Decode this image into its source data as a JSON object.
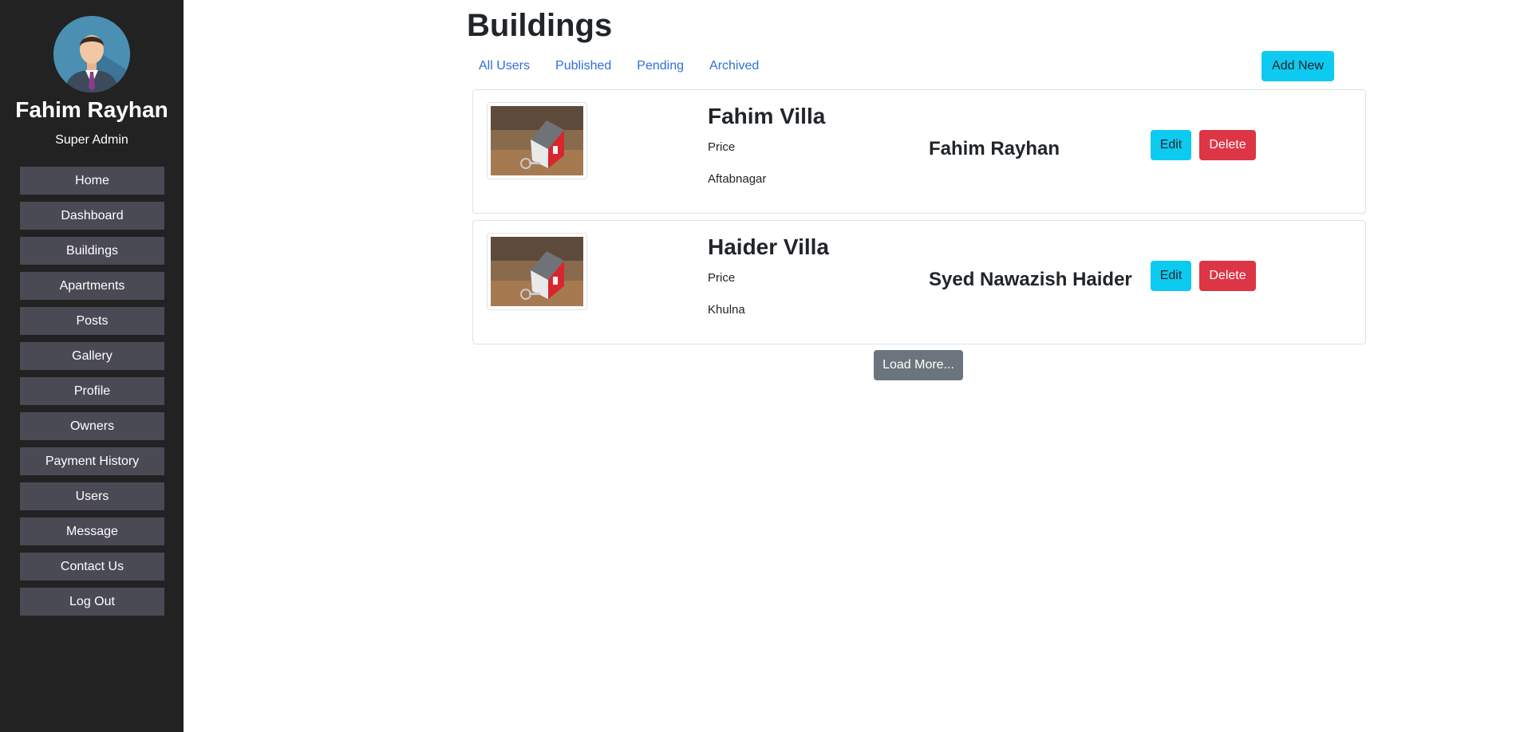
{
  "sidebar": {
    "user_name": "Fahim Rayhan",
    "user_role": "Super Admin",
    "items": [
      {
        "label": "Home"
      },
      {
        "label": "Dashboard"
      },
      {
        "label": "Buildings"
      },
      {
        "label": "Apartments"
      },
      {
        "label": "Posts"
      },
      {
        "label": "Gallery"
      },
      {
        "label": "Profile"
      },
      {
        "label": "Owners"
      },
      {
        "label": "Payment History"
      },
      {
        "label": "Users"
      },
      {
        "label": "Message"
      },
      {
        "label": "Contact Us"
      },
      {
        "label": "Log Out"
      }
    ]
  },
  "main": {
    "title": "Buildings",
    "tabs": [
      {
        "label": "All Users"
      },
      {
        "label": "Published"
      },
      {
        "label": "Pending"
      },
      {
        "label": "Archived"
      }
    ],
    "add_new_label": "Add New",
    "load_more_label": "Load More...",
    "buildings": [
      {
        "name": "Fahim Villa",
        "price_label": "Price",
        "location": "Aftabnagar",
        "owner": "Fahim Rayhan",
        "edit_label": "Edit",
        "delete_label": "Delete"
      },
      {
        "name": "Haider Villa",
        "price_label": "Price",
        "location": "Khulna",
        "owner": "Syed Nawazish Haider",
        "edit_label": "Edit",
        "delete_label": "Delete"
      }
    ]
  },
  "colors": {
    "sidebar_bg": "#222222",
    "nav_item_bg": "#4a4a55",
    "link": "#2f6fd8",
    "info": "#0dcaf0",
    "danger": "#dc3545",
    "secondary": "#6c757d"
  }
}
